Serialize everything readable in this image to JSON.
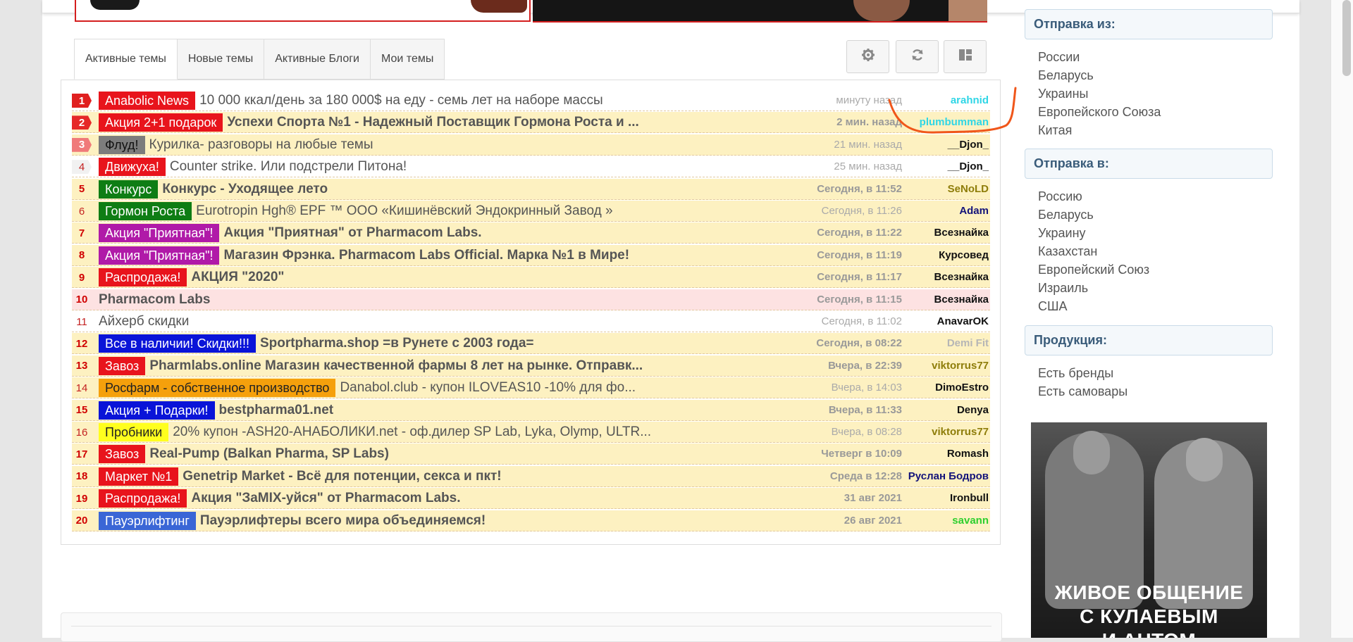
{
  "tabs": [
    "Активные темы",
    "Новые темы",
    "Активные Блоги",
    "Мои темы"
  ],
  "toolbar": {
    "icons": [
      "gear-icon",
      "refresh-icon",
      "layout-icon"
    ]
  },
  "topics": [
    {
      "num": "1",
      "prefix": "Anabolic News",
      "prefix_bg": "#e8141c",
      "title": "10 000 ккал/день за 180 000$ на еду - семь лет на наборе массы",
      "title_bold": false,
      "time": "минуту назад",
      "time_bold": false,
      "author": "arahnid",
      "author_color": "#2fd6e6",
      "row": "white",
      "num_style": "f1"
    },
    {
      "num": "2",
      "prefix": "Акция 2+1 подарок",
      "prefix_bg": "#e8141c",
      "title": "Успехи Спорта №1 - Надежный Поставщик Гормона Роста и ...",
      "title_bold": true,
      "time": "2 мин. назад",
      "time_bold": true,
      "author": "plumbumman",
      "author_color": "#2fd6e6",
      "row": "yellow",
      "num_style": "f2"
    },
    {
      "num": "3",
      "prefix": "Флуд!",
      "prefix_bg": "#7c7c7c",
      "prefix_color": "#111111",
      "title": "Курилка- разговоры на любые темы",
      "title_bold": false,
      "time": "21 мин. назад",
      "time_bold": false,
      "author": "__Djon_",
      "author_color": "#111111",
      "row": "yellow",
      "num_style": "f3"
    },
    {
      "num": "4",
      "prefix": "Движуха!",
      "prefix_bg": "#e8141c",
      "title": "Counter strike. Или подстрели Питона!",
      "title_bold": false,
      "time": "25 мин. назад",
      "time_bold": false,
      "author": "__Djon_",
      "author_color": "#111111",
      "row": "white",
      "num_style": "f4"
    },
    {
      "num": "5",
      "prefix": "Конкурс",
      "prefix_bg": "#0e7d14",
      "title": "Конкурс - Уходящее лето",
      "title_bold": true,
      "time": "Сегодня, в 11:52",
      "time_bold": true,
      "author": "SeNoLD",
      "author_color": "#8e7d0a",
      "row": "yellow",
      "num_style": "bold"
    },
    {
      "num": "6",
      "prefix": "Гормон Роста",
      "prefix_bg": "#0e7d14",
      "title": "Eurotropin Hgh® EPF ™ ООО «Кишинёвский Эндокринный Завод »",
      "title_bold": false,
      "time": "Сегодня, в 11:26",
      "time_bold": false,
      "author": "Adam",
      "author_color": "#13137a",
      "row": "yellow",
      "num_style": "plain"
    },
    {
      "num": "7",
      "prefix": "Акция \"Приятная\"!",
      "prefix_bg": "#b01aa8",
      "title": "Акция \"Приятная\" от Pharmacom Labs.",
      "title_bold": true,
      "time": "Сегодня, в 11:22",
      "time_bold": true,
      "author": "Всезнайка",
      "author_color": "#111111",
      "row": "yellow",
      "num_style": "bold"
    },
    {
      "num": "8",
      "prefix": "Акция \"Приятная\"!",
      "prefix_bg": "#b01aa8",
      "title": "Магазин Фрэнка. Pharmacom Labs Official. Марка №1 в Мире!",
      "title_bold": true,
      "time": "Сегодня, в 11:19",
      "time_bold": true,
      "author": "Курсовед",
      "author_color": "#111111",
      "row": "yellow",
      "num_style": "bold"
    },
    {
      "num": "9",
      "prefix": "Распродажа!",
      "prefix_bg": "#e8141c",
      "title": "АКЦИЯ \"2020\"",
      "title_bold": true,
      "time": "Сегодня, в 11:17",
      "time_bold": true,
      "author": "Всезнайка",
      "author_color": "#111111",
      "row": "yellow",
      "num_style": "bold"
    },
    {
      "num": "10",
      "prefix": "",
      "prefix_bg": "",
      "title": "Pharmacom Labs",
      "title_bold": true,
      "time": "Сегодня, в 11:15",
      "time_bold": true,
      "author": "Всезнайка",
      "author_color": "#111111",
      "row": "pink",
      "num_style": "bold"
    },
    {
      "num": "11",
      "prefix": "",
      "prefix_bg": "",
      "title": "Айхерб скидки",
      "title_bold": false,
      "time": "Сегодня, в 11:02",
      "time_bold": false,
      "author": "AnavarOK",
      "author_color": "#111111",
      "row": "white",
      "num_style": "plain"
    },
    {
      "num": "12",
      "prefix": "Все в наличии! Скидки!!!",
      "prefix_bg": "#0a14d8",
      "title": "Sportpharma.shop =в Рунете с 2003 года=",
      "title_bold": true,
      "time": "Сегодня, в 08:22",
      "time_bold": true,
      "author": "Demi Fit",
      "author_color": "#b6b6b6",
      "row": "yellow",
      "num_style": "bold"
    },
    {
      "num": "13",
      "prefix": "Завоз",
      "prefix_bg": "#e8141c",
      "title": "Pharmlabs.online Магазин качественной фармы 8 лет на рынке. Отправк...",
      "title_bold": true,
      "time": "Вчера, в 22:39",
      "time_bold": true,
      "author": "viktorrus77",
      "author_color": "#8e7d0a",
      "row": "yellow",
      "num_style": "bold"
    },
    {
      "num": "14",
      "prefix": "Росфарм - собственное производство",
      "prefix_bg": "#f5a00c",
      "prefix_color": "#222222",
      "title": "Danabol.club - купон ILOVEAS10 -10% для фо...",
      "title_bold": false,
      "time": "Вчера, в 14:03",
      "time_bold": false,
      "author": "DimoEstro",
      "author_color": "#111111",
      "row": "yellow",
      "num_style": "plain"
    },
    {
      "num": "15",
      "prefix": "Акция + Подарки!",
      "prefix_bg": "#0a14d8",
      "title": "bestpharma01.net",
      "title_bold": true,
      "time": "Вчера, в 11:33",
      "time_bold": true,
      "author": "Denya",
      "author_color": "#111111",
      "row": "yellow",
      "num_style": "bold"
    },
    {
      "num": "16",
      "prefix": "Пробники",
      "prefix_bg": "#ffff1e",
      "prefix_color": "#222222",
      "title": "20% купон -ASH20-АНАБОЛИКИ.net - оф.дилер SP Lab, Lyka, Olymp, ULTR...",
      "title_bold": false,
      "time": "Вчера, в 08:28",
      "time_bold": false,
      "author": "viktorrus77",
      "author_color": "#8e7d0a",
      "row": "yellow",
      "num_style": "plain"
    },
    {
      "num": "17",
      "prefix": "Завоз",
      "prefix_bg": "#e8141c",
      "title": "Real-Pump (Balkan Pharma, SP Labs)",
      "title_bold": true,
      "time": "Четверг в 10:09",
      "time_bold": true,
      "author": "Romash",
      "author_color": "#111111",
      "row": "yellow",
      "num_style": "bold"
    },
    {
      "num": "18",
      "prefix": "Маркет №1",
      "prefix_bg": "#e8141c",
      "title": "Genetrip Market - Всё для потенции, секса и пкт!",
      "title_bold": true,
      "time": "Среда в 12:28",
      "time_bold": true,
      "author": "Руслан Бодров",
      "author_color": "#13137a",
      "row": "yellow",
      "num_style": "bold"
    },
    {
      "num": "19",
      "prefix": "Распродажа!",
      "prefix_bg": "#e8141c",
      "title": "Акция \"ЗаMIX-уйся\" от Pharmacom Labs.",
      "title_bold": true,
      "time": "31 авг 2021",
      "time_bold": true,
      "author": "Ironbull",
      "author_color": "#111111",
      "row": "yellow",
      "num_style": "bold"
    },
    {
      "num": "20",
      "prefix": "Пауэрлифтинг",
      "prefix_bg": "#3a66d6",
      "title": "Пауэрлифтеры всего мира объединяемся!",
      "title_bold": true,
      "time": "26 авг 2021",
      "time_bold": true,
      "author": "savann",
      "author_color": "#2ecf2e",
      "row": "yellow",
      "num_style": "bold"
    }
  ],
  "sidebar": {
    "from": {
      "title": "Отправка из:",
      "items": [
        "России",
        "Беларусь",
        "Украины",
        "Европейского Союза",
        "Китая"
      ]
    },
    "to": {
      "title": "Отправка в:",
      "items": [
        "Россию",
        "Беларусь",
        "Украину",
        "Казахстан",
        "Европейский Союз",
        "Израиль",
        "США"
      ]
    },
    "products": {
      "title": "Продукция:",
      "items": [
        "Есть бренды",
        "Есть самовары"
      ]
    },
    "ad": {
      "line1": "ЖИВОЕ ОБЩЕНИЕ",
      "line2": "С КУЛАЕВЫМ",
      "line3": "И АНТОМ"
    }
  },
  "colors": {
    "accent": "#3a5c7a",
    "annotation": "#f0561a",
    "row_yellow": "#fdf1c1",
    "row_pink": "#fde2e2"
  }
}
